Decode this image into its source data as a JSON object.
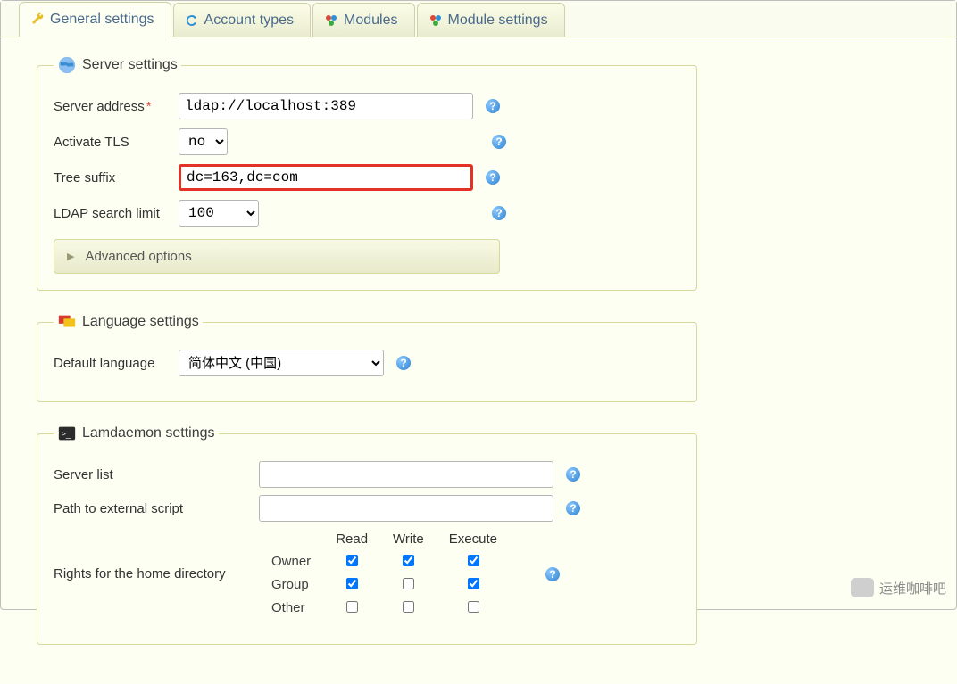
{
  "tabs": {
    "general": "General settings",
    "accounts": "Account types",
    "modules": "Modules",
    "module_settings": "Module settings"
  },
  "server": {
    "legend": "Server settings",
    "address_label": "Server address",
    "address_value": "ldap://localhost:389",
    "tls_label": "Activate TLS",
    "tls_value": "no",
    "tree_label": "Tree suffix",
    "tree_value": "dc=163,dc=com",
    "limit_label": "LDAP search limit",
    "limit_value": "100",
    "advanced_label": "Advanced options"
  },
  "language": {
    "legend": "Language settings",
    "default_label": "Default language",
    "default_value": "简体中文 (中国)"
  },
  "lamdaemon": {
    "legend": "Lamdaemon settings",
    "server_list_label": "Server list",
    "server_list_value": "",
    "script_label": "Path to external script",
    "script_value": "",
    "rights_label": "Rights for the home directory",
    "cols": {
      "read": "Read",
      "write": "Write",
      "execute": "Execute"
    },
    "rows": {
      "owner": "Owner",
      "group": "Group",
      "other": "Other"
    },
    "chk": {
      "owner_read": true,
      "owner_write": true,
      "owner_execute": true,
      "group_read": true,
      "group_write": false,
      "group_execute": true,
      "other_read": false,
      "other_write": false,
      "other_execute": false
    }
  },
  "watermark": "运维咖啡吧"
}
